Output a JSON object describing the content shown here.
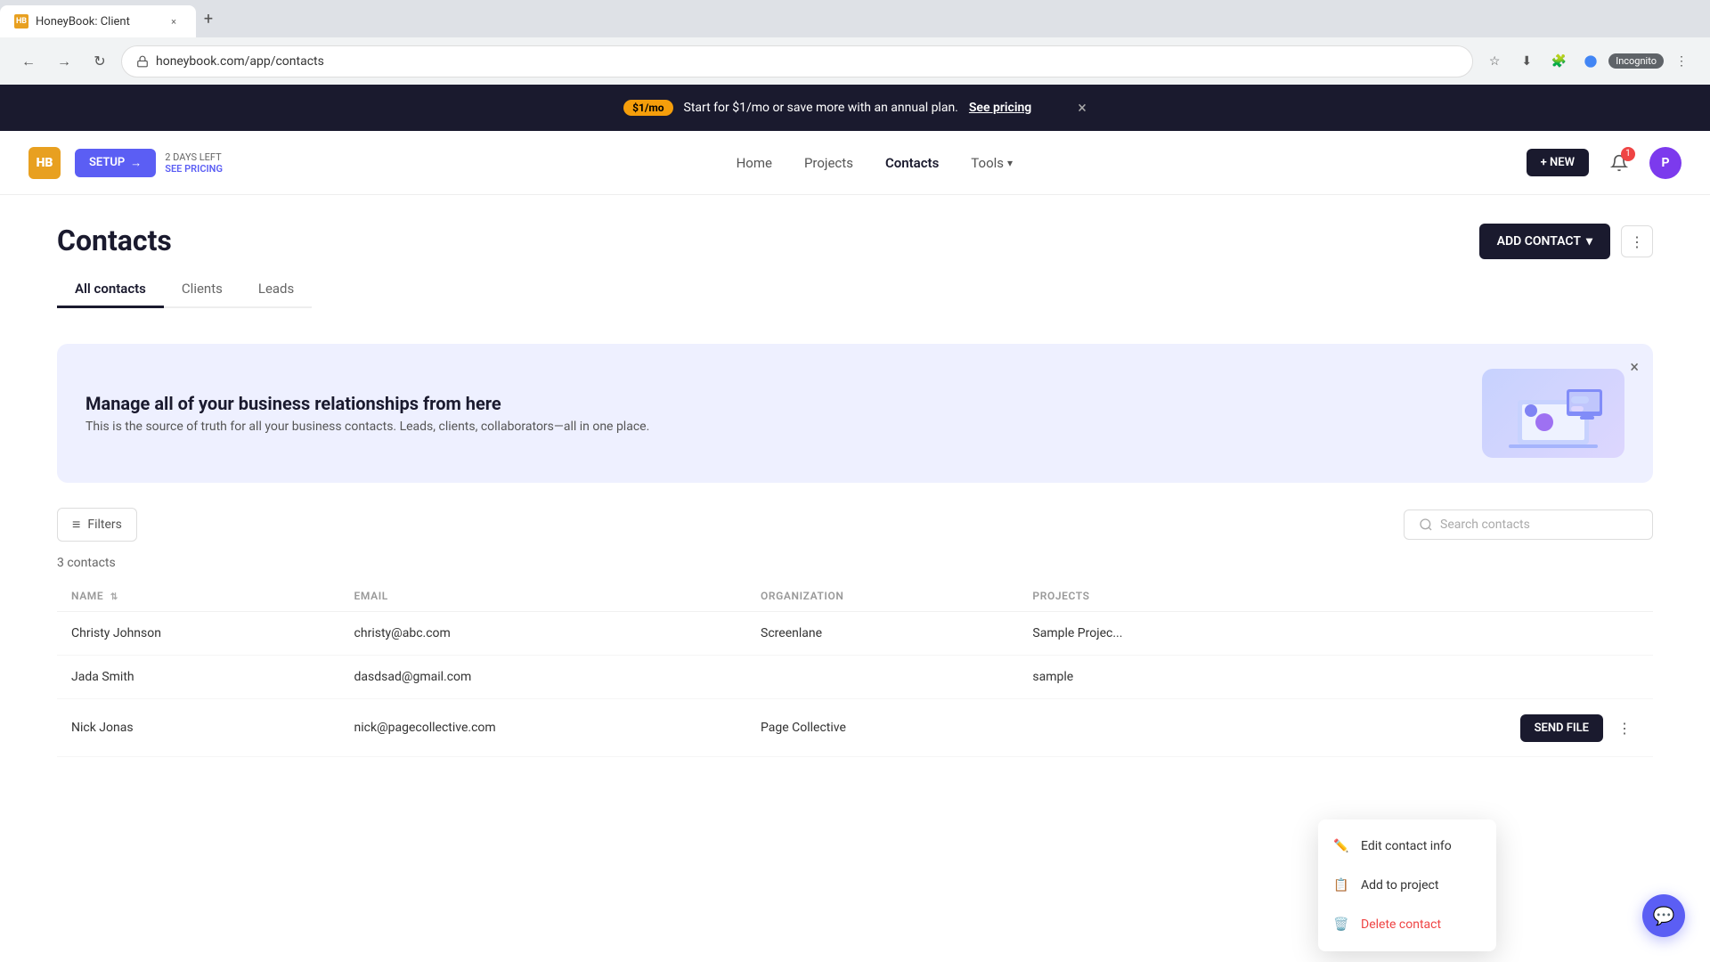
{
  "browser": {
    "tab_title": "HoneyBook: Client",
    "url": "honeybook.com/app/contacts",
    "tab_close": "×",
    "new_tab": "+",
    "back": "←",
    "forward": "→",
    "reload": "↻",
    "incognito": "Incognito",
    "profile_initial": "P"
  },
  "promo_banner": {
    "badge": "$1/mo",
    "text": "Start for $1/mo or save more with an annual plan.",
    "link": "See pricing",
    "close": "×"
  },
  "header": {
    "logo": "HB",
    "setup_label": "SETUP",
    "setup_icon": "→",
    "days_left": "2 DAYS LEFT",
    "see_pricing": "SEE PRICING",
    "nav_items": [
      {
        "label": "Home",
        "active": false
      },
      {
        "label": "Projects",
        "active": false
      },
      {
        "label": "Contacts",
        "active": true
      },
      {
        "label": "Tools",
        "active": false
      }
    ],
    "tools_dropdown": "▾",
    "new_btn": "+ NEW",
    "notif_count": "1",
    "user_initial": "P"
  },
  "page": {
    "title": "Contacts",
    "tabs": [
      {
        "label": "All contacts",
        "active": true
      },
      {
        "label": "Clients",
        "active": false
      },
      {
        "label": "Leads",
        "active": false
      }
    ],
    "add_contact_btn": "ADD CONTACT",
    "add_contact_icon": "▾",
    "more_actions": "⋮"
  },
  "info_banner": {
    "heading": "Manage all of your business relationships from here",
    "body": "This is the source of truth for all your business contacts. Leads, clients, collaborators—all in one place.",
    "close": "×"
  },
  "controls": {
    "filter_btn": "Filters",
    "filter_icon": "≡",
    "search_placeholder": "Search contacts"
  },
  "contacts": {
    "count_label": "3 contacts",
    "columns": [
      {
        "label": "NAME",
        "sortable": true
      },
      {
        "label": "EMAIL",
        "sortable": false
      },
      {
        "label": "ORGANIZATION",
        "sortable": false
      },
      {
        "label": "PROJECTS",
        "sortable": false
      }
    ],
    "rows": [
      {
        "name": "Christy Johnson",
        "email": "christy@abc.com",
        "organization": "Screenlane",
        "projects": "Sample Projec..."
      },
      {
        "name": "Jada Smith",
        "email": "dasdsad@gmail.com",
        "organization": "",
        "projects": "sample"
      },
      {
        "name": "Nick Jonas",
        "email": "nick@pagecollective.com",
        "organization": "Page Collective",
        "projects": ""
      }
    ]
  },
  "context_menu": {
    "items": [
      {
        "label": "Edit contact info",
        "icon": "✏️",
        "type": "normal"
      },
      {
        "label": "Add to project",
        "icon": "📋",
        "type": "normal"
      },
      {
        "label": "Delete contact",
        "icon": "🗑️",
        "type": "danger"
      }
    ]
  },
  "row_actions": {
    "send_file": "SEND FILE",
    "more": "⋮"
  },
  "chat_btn": "💬"
}
